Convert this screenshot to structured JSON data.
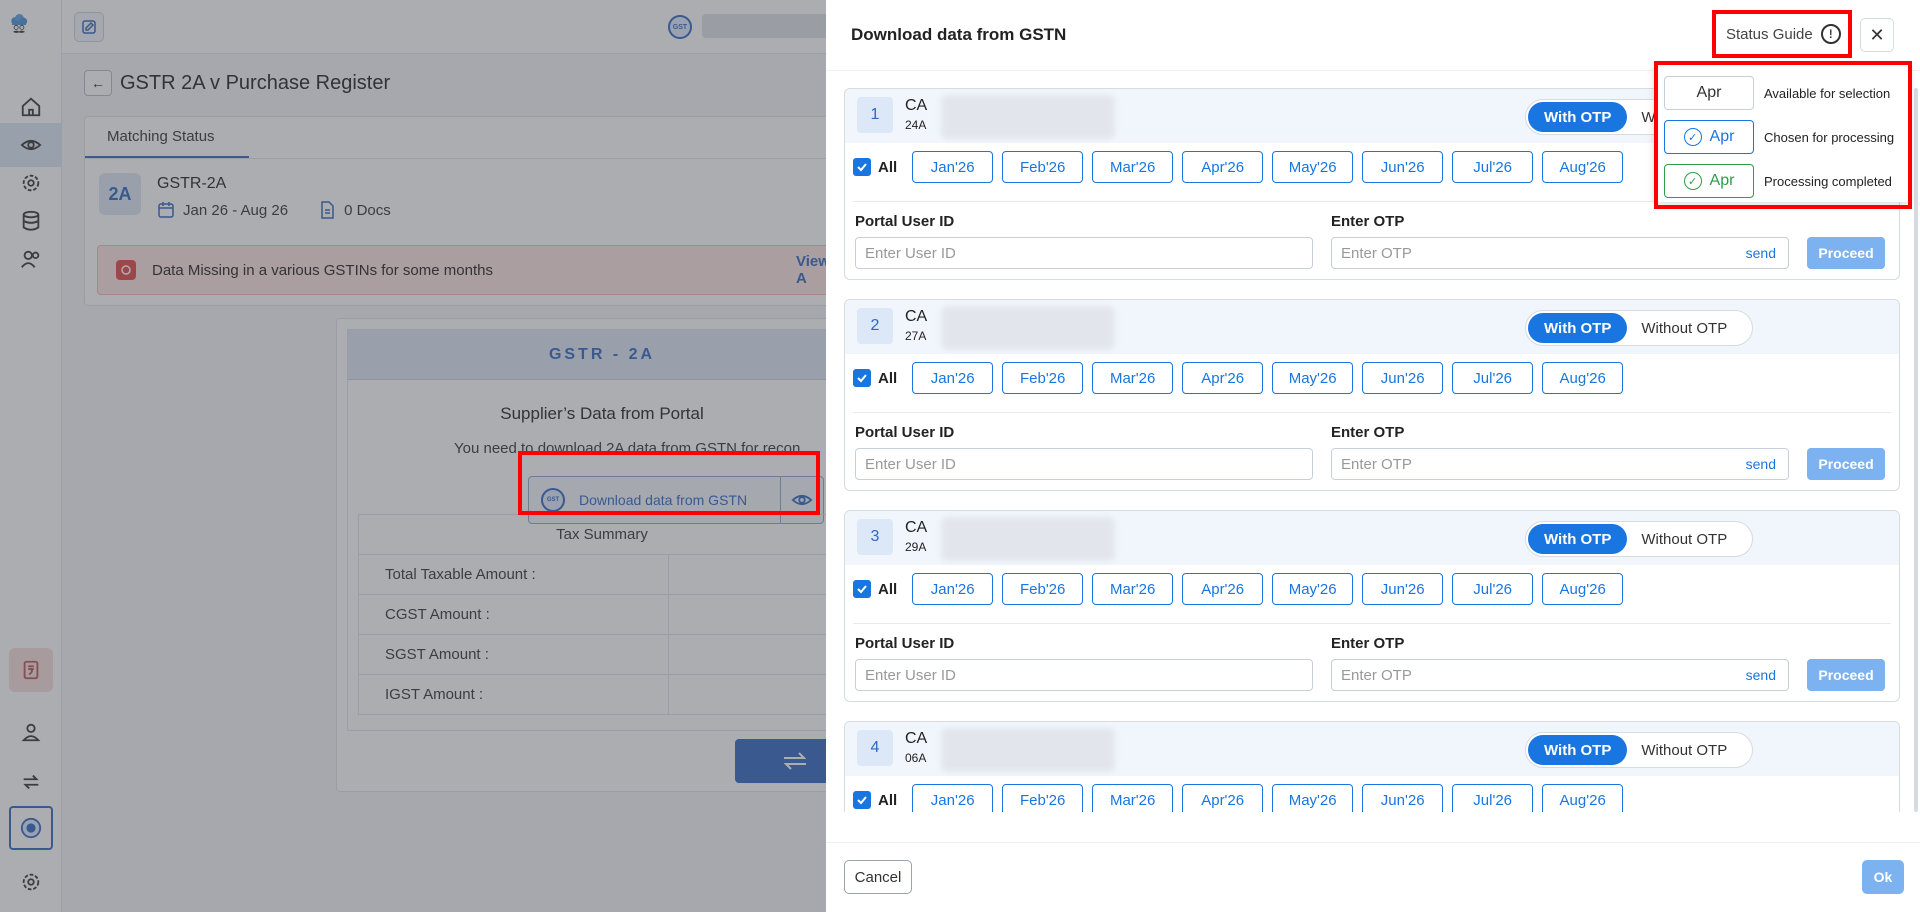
{
  "background": {
    "page_title": "GSTR 2A v Purchase Register",
    "matching_tab": "Matching Status",
    "return_badge": "2A",
    "return_name": "GSTR-2A",
    "period": "Jan 26 - Aug 26",
    "docs": "0 Docs",
    "alert_text": "Data Missing in a various GSTINs for some months",
    "alert_link": "View A",
    "gstr_header": "GSTR - 2A",
    "gstr_subtitle": "Supplier’s Data from Portal",
    "gstr_desc": "You need to download 2A data from GSTN for recon",
    "download_label": "Download data from GSTN",
    "tax_summary_title": "Tax Summary",
    "tax_rows": [
      "Total Taxable Amount :",
      "CGST Amount :",
      "SGST Amount :",
      "IGST Amount :"
    ]
  },
  "modal": {
    "title": "Download data from GSTN",
    "status_guide_label": "Status Guide",
    "close_symbol": "✕",
    "cancel_label": "Cancel",
    "ok_label": "Ok",
    "all_label": "All",
    "portal_user_label": "Portal User ID",
    "otp_label": "Enter OTP",
    "user_placeholder": "Enter User ID",
    "otp_placeholder": "Enter OTP",
    "send_label": "send",
    "proceed_label": "Proceed",
    "with_otp": "With OTP",
    "without_otp": "Without OTP",
    "months": [
      "Jan'26",
      "Feb'26",
      "Mar'26",
      "Apr'26",
      "May'26",
      "Jun'26",
      "Jul'26",
      "Aug'26"
    ],
    "gstins": [
      {
        "num": "1",
        "name": "CA",
        "code": "24A"
      },
      {
        "num": "2",
        "name": "CA",
        "code": "27A"
      },
      {
        "num": "3",
        "name": "CA",
        "code": "29A"
      },
      {
        "num": "4",
        "name": "CA",
        "code": "06A"
      }
    ]
  },
  "status_guide": [
    {
      "chip": "Apr",
      "text": "Available for selection",
      "state": "available"
    },
    {
      "chip": "Apr",
      "text": "Chosen for processing",
      "state": "chosen"
    },
    {
      "chip": "Apr",
      "text": "Processing completed",
      "state": "completed"
    }
  ],
  "colors": {
    "accent": "#1976e0",
    "completed": "#2e9e4a",
    "highlight": "#ff0000"
  },
  "icons": [
    "cloud-mustache-logo-icon",
    "home-icon",
    "eye-icon",
    "gear-icon",
    "database-icon",
    "users-icon",
    "rupee-icon",
    "user-tie-icon",
    "arrows-icon",
    "gst-icon",
    "settings-icon"
  ]
}
